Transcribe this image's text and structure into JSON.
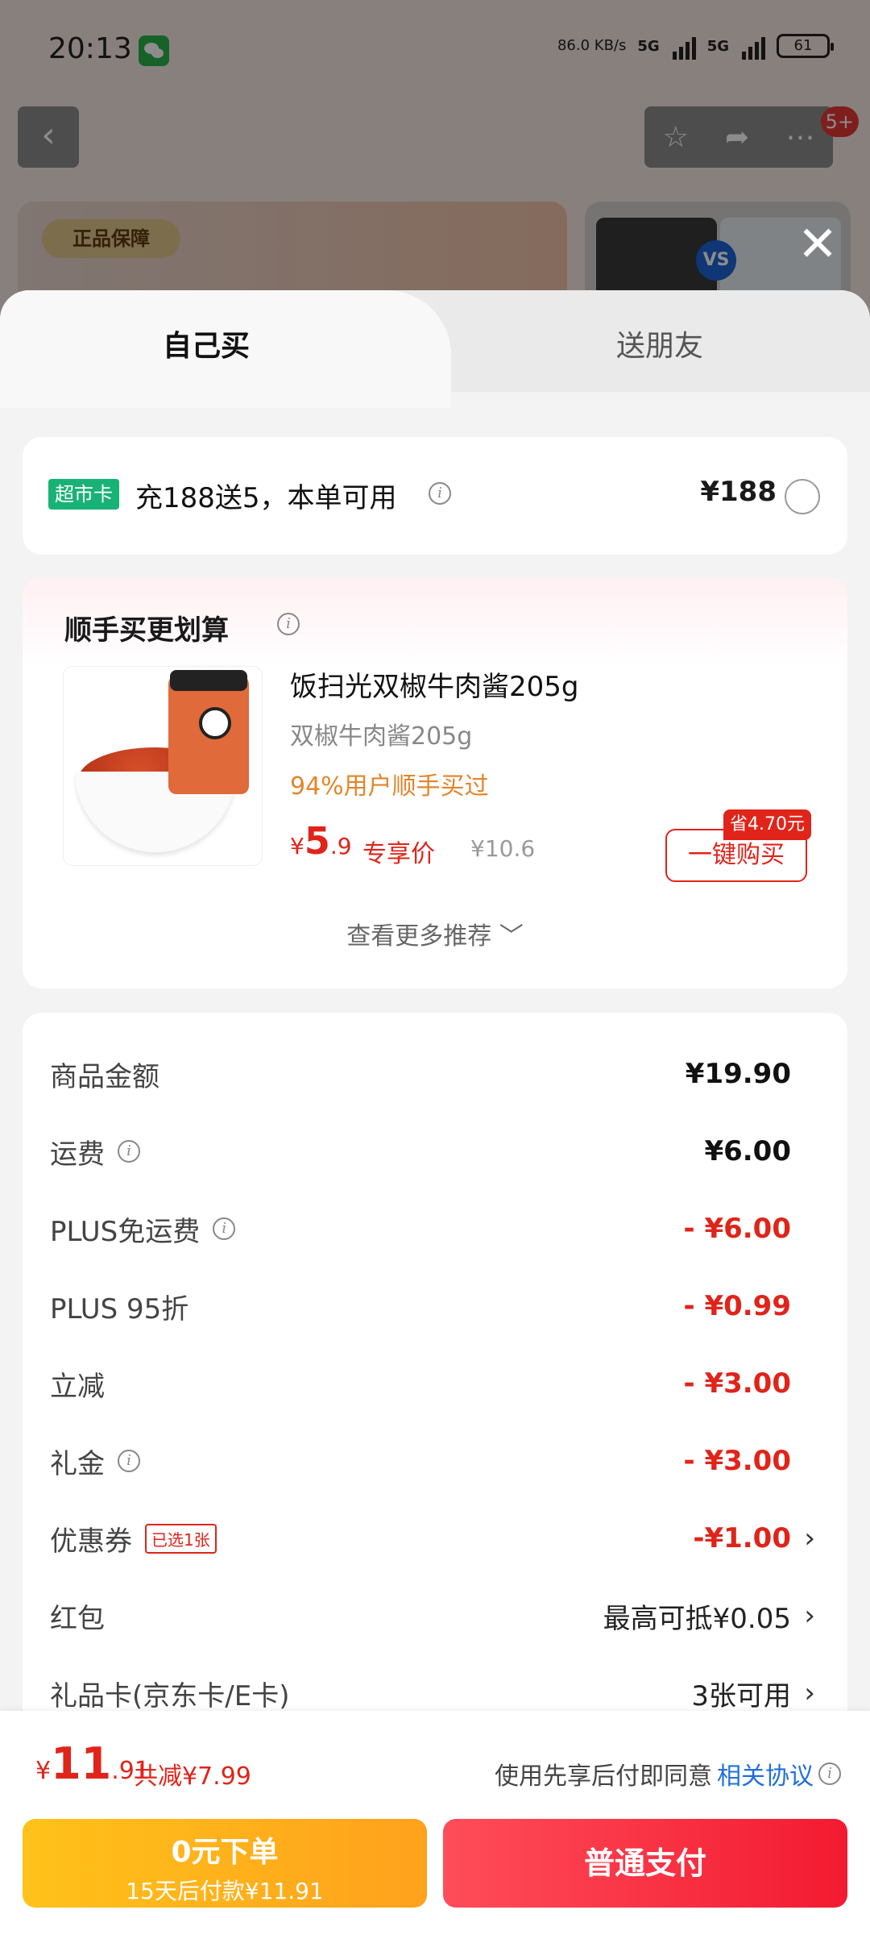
{
  "status": {
    "time": "20:13",
    "net_speed": "86.0 KB/s",
    "net1": "5G",
    "net2": "5G",
    "battery": "61"
  },
  "topbar": {
    "back": "‹",
    "badge": "5+"
  },
  "background": {
    "genuine_tag": "正品保障",
    "vs": "VS"
  },
  "tabs": {
    "self": "自己买",
    "friend": "送朋友"
  },
  "promo": {
    "badge": "超市卡",
    "text": "充188送5，本单可用",
    "price": "¥188"
  },
  "addon": {
    "title": "顺手买更划算",
    "product": {
      "name": "饭扫光双椒牛肉酱205g",
      "spec": "双椒牛肉酱205g",
      "percent": "94%用户顺手买过",
      "currency": "¥",
      "price_int": "5",
      "price_dec": ".9",
      "exclusive": "专享价",
      "orig_price": "¥10.6",
      "save_badge": "省4.70元",
      "buy_label": "一键购买"
    },
    "more": "查看更多推荐 ﹀"
  },
  "summary": {
    "rows": [
      {
        "label": "商品金额",
        "value": "¥19.90"
      },
      {
        "label": "运费",
        "value": "¥6.00"
      },
      {
        "label": "PLUS免运费",
        "value": "- ¥6.00"
      },
      {
        "label": "PLUS 95折",
        "value": "- ¥0.99"
      },
      {
        "label": "立减",
        "value": "- ¥3.00"
      },
      {
        "label": "礼金",
        "value": "- ¥3.00"
      },
      {
        "label": "优惠券",
        "tag": "已选1张",
        "value": "-¥1.00"
      },
      {
        "label": "红包",
        "value": "最高可抵¥0.05"
      },
      {
        "label": "礼品卡(京东卡/E卡)",
        "value": "3张可用"
      }
    ]
  },
  "bottom": {
    "currency": "¥",
    "total_int": "11",
    "total_dec": ".91",
    "saved": "共减¥7.99",
    "agree_text": "使用先享后付即同意",
    "agree_link": "相关协议",
    "zero_btn_line1": "0元下单",
    "zero_btn_line2": "15天后付款¥11.91",
    "pay_btn": "普通支付"
  },
  "colors": {
    "accent_red": "#e0241a",
    "green_badge": "#19b276",
    "link_blue": "#1f6fde",
    "orange_pct": "#e2862a"
  }
}
